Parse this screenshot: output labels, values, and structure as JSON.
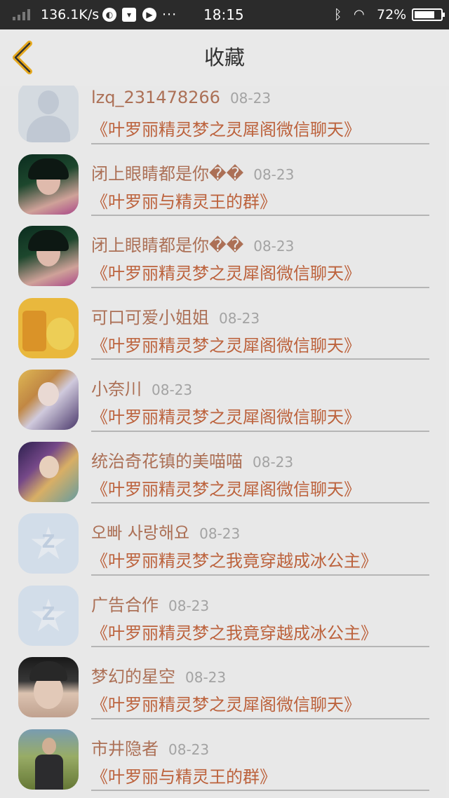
{
  "status_bar": {
    "net_speed": "136.1K/s",
    "dots": "···",
    "time": "18:15",
    "battery": "72%",
    "icons": [
      "signal-icon",
      "browser-icon",
      "bag-icon",
      "media-icon",
      "bluetooth-icon",
      "wifi-icon",
      "battery-icon"
    ]
  },
  "nav": {
    "title": "收藏",
    "back_icon": "chevron-left-icon",
    "accent_color": "#f0b020"
  },
  "items": [
    {
      "name": "lzq_231478266",
      "date": "08-23",
      "group": "《叶罗丽精灵梦之灵犀阁微信聊天》",
      "avatar": "default-user-avatar"
    },
    {
      "name": "闭上眼睛都是你��",
      "date": "08-23",
      "group": "《叶罗丽与精灵王的群》",
      "avatar": "girl-avatar"
    },
    {
      "name": "闭上眼睛都是你��",
      "date": "08-23",
      "group": "《叶罗丽精灵梦之灵犀阁微信聊天》",
      "avatar": "girl-avatar"
    },
    {
      "name": "可口可爱小姐姐",
      "date": "08-23",
      "group": "《叶罗丽精灵梦之灵犀阁微信聊天》",
      "avatar": "pikachu-avatar"
    },
    {
      "name": "小奈川",
      "date": "08-23",
      "group": "《叶罗丽精灵梦之灵犀阁微信聊天》",
      "avatar": "anime-avatar"
    },
    {
      "name": "统治奇花镇的美喵喵",
      "date": "08-23",
      "group": "《叶罗丽精灵梦之灵犀阁微信聊天》",
      "avatar": "anime-avatar"
    },
    {
      "name": "오빠 사랑해요",
      "date": "08-23",
      "group": "《叶罗丽精灵梦之我竟穿越成冰公主》",
      "avatar": "qzone-star-avatar"
    },
    {
      "name": "广告合作",
      "date": "08-23",
      "group": "《叶罗丽精灵梦之我竟穿越成冰公主》",
      "avatar": "qzone-star-avatar"
    },
    {
      "name": "梦幻的星空",
      "date": "08-23",
      "group": "《叶罗丽精灵梦之灵犀阁微信聊天》",
      "avatar": "boy-avatar"
    },
    {
      "name": "市井隐者",
      "date": "08-23",
      "group": "《叶罗丽与精灵王的群》",
      "avatar": "man-avatar"
    }
  ]
}
